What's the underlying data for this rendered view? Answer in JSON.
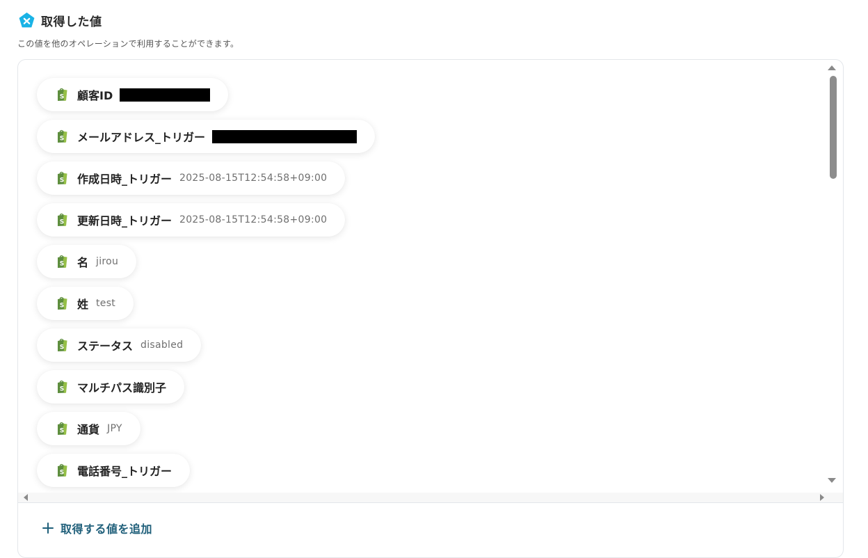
{
  "header": {
    "title": "取得した値",
    "description": "この値を他のオペレーションで利用することができます。"
  },
  "items": [
    {
      "label": "顧客ID",
      "value": "",
      "redacted": true
    },
    {
      "label": "メールアドレス_トリガー",
      "value": "",
      "redacted": true
    },
    {
      "label": "作成日時_トリガー",
      "value": "2025-08-15T12:54:58+09:00"
    },
    {
      "label": "更新日時_トリガー",
      "value": "2025-08-15T12:54:58+09:00"
    },
    {
      "label": "名",
      "value": "jirou"
    },
    {
      "label": "姓",
      "value": "test"
    },
    {
      "label": "ステータス",
      "value": "disabled"
    },
    {
      "label": "マルチパス識別子",
      "value": ""
    },
    {
      "label": "通貨",
      "value": "JPY"
    },
    {
      "label": "電話番号_トリガー",
      "value": ""
    }
  ],
  "footer": {
    "add_label": "取得する値を追加"
  },
  "icons": {
    "header": "yoom-badge-icon",
    "item": "shopify-icon",
    "add": "plus-icon"
  },
  "colors": {
    "accent": "#1f5f7a",
    "badge": "#1ab3e6",
    "shopify_dark": "#5e8e3e",
    "shopify_light": "#95bf47"
  }
}
